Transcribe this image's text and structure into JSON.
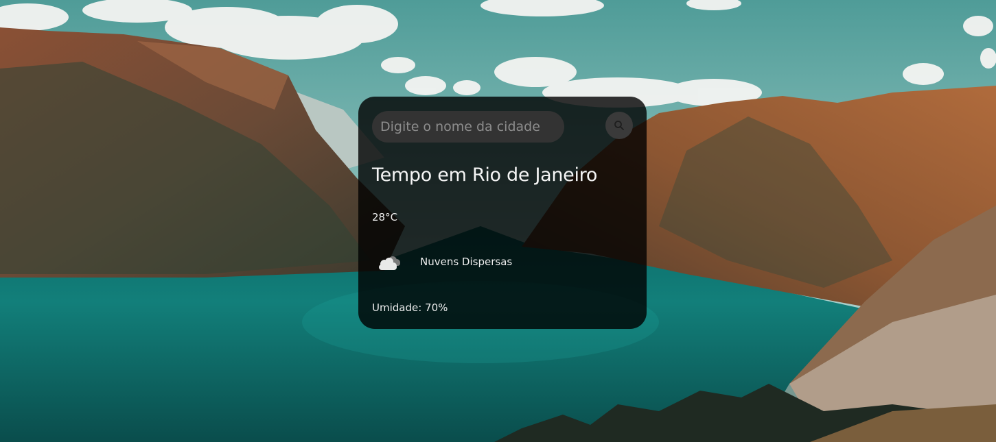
{
  "search": {
    "placeholder": "Digite o nome da cidade",
    "button_icon": "search-icon"
  },
  "weather": {
    "title": "Tempo em Rio de Janeiro",
    "temperature": "28°C",
    "condition": "Nuvens Dispersas",
    "condition_icon": "scattered-clouds-icon",
    "humidity": "Umidade: 70%"
  },
  "colors": {
    "card_bg": "#000000cc",
    "text": "#f2f2f2",
    "input_bg": "#333333"
  }
}
